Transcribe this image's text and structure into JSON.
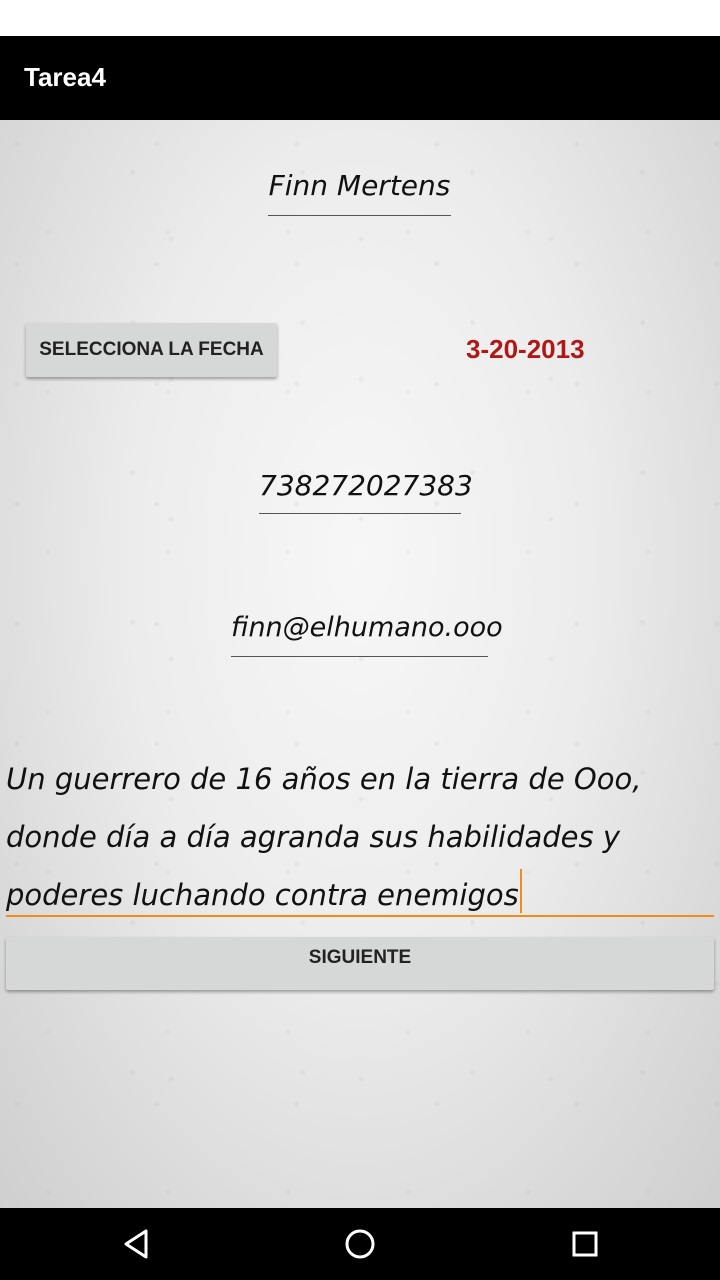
{
  "app": {
    "title": "Tarea4"
  },
  "form": {
    "name_value": "Finn Mertens",
    "date_button_label": "SELECCIONA LA FECHA",
    "date_value": "3-20-2013",
    "phone_value": "738272027383",
    "email_value": "finn@elhumano.ooo",
    "bio_value": "Un guerrero de 16 años en la tierra de Ooo, donde día a día agranda sus habilidades y poderes luchando contra enemigos",
    "next_button_label": "SIGUIENTE"
  },
  "colors": {
    "app_bar": "#000000",
    "date_text": "#b01818",
    "focus_underline": "#f08c1a",
    "button_bg": "#d6d7d7"
  },
  "nav": {
    "icons": [
      "back-icon",
      "home-icon",
      "recent-apps-icon"
    ]
  }
}
